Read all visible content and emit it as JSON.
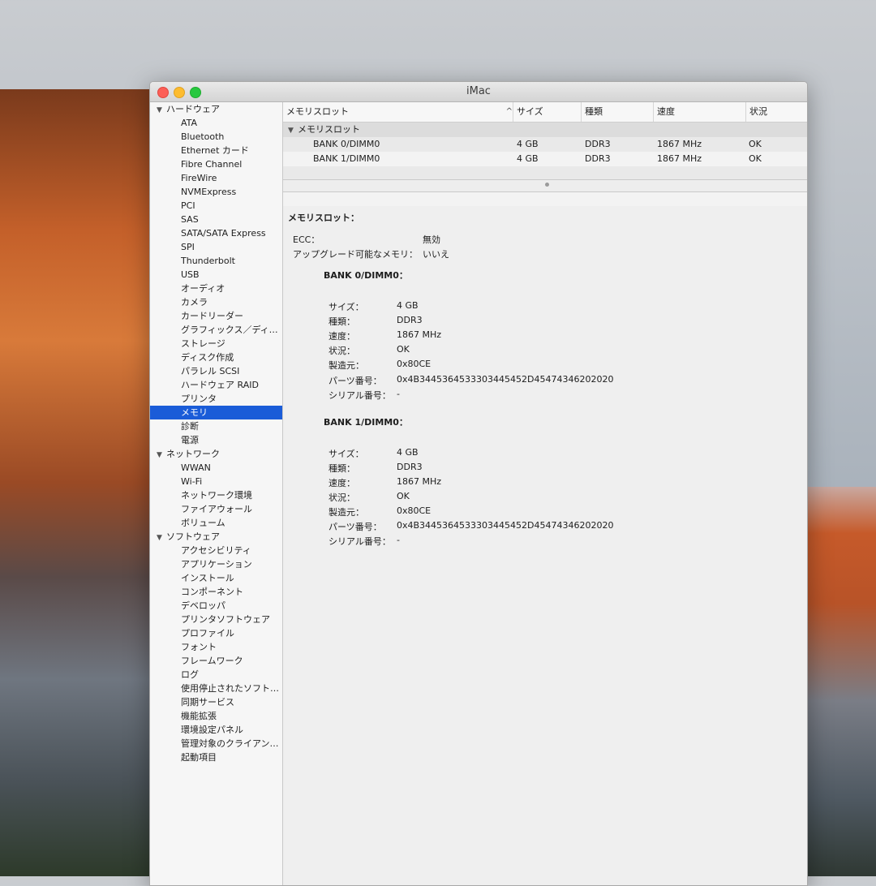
{
  "window": {
    "title": "iMac"
  },
  "sidebar": {
    "groups": [
      {
        "label": "ハードウェア",
        "items": [
          "ATA",
          "Bluetooth",
          "Ethernet カード",
          "Fibre Channel",
          "FireWire",
          "NVMExpress",
          "PCI",
          "SAS",
          "SATA/SATA Express",
          "SPI",
          "Thunderbolt",
          "USB",
          "オーディオ",
          "カメラ",
          "カードリーダー",
          "グラフィックス／ディ…",
          "ストレージ",
          "ディスク作成",
          "パラレル SCSI",
          "ハードウェア RAID",
          "プリンタ",
          "メモリ",
          "診断",
          "電源"
        ]
      },
      {
        "label": "ネットワーク",
        "items": [
          "WWAN",
          "Wi-Fi",
          "ネットワーク環境",
          "ファイアウォール",
          "ボリューム"
        ]
      },
      {
        "label": "ソフトウェア",
        "items": [
          "アクセシビリティ",
          "アプリケーション",
          "インストール",
          "コンポーネント",
          "デベロッパ",
          "プリンタソフトウェア",
          "プロファイル",
          "フォント",
          "フレームワーク",
          "ログ",
          "使用停止されたソフト…",
          "同期サービス",
          "機能拡張",
          "環境設定パネル",
          "管理対象のクライアン…",
          "起動項目"
        ]
      }
    ],
    "selected": "メモリ"
  },
  "table": {
    "headers": [
      "メモリスロット",
      "サイズ",
      "種類",
      "速度",
      "状況"
    ],
    "sort_indicator": "^",
    "group_label": "メモリスロット",
    "rows": [
      [
        "BANK 0/DIMM0",
        "4 GB",
        "DDR3",
        "1867 MHz",
        "OK"
      ],
      [
        "BANK 1/DIMM0",
        "4 GB",
        "DDR3",
        "1867 MHz",
        "OK"
      ]
    ]
  },
  "detail": {
    "title": "メモリスロット：",
    "ecc_label": "ECC：",
    "ecc_value": "無効",
    "upgrade_label": "アップグレード可能なメモリ：",
    "upgrade_value": "いいえ",
    "banks": [
      {
        "title": "BANK 0/DIMM0：",
        "fields": [
          [
            "サイズ：",
            "4 GB"
          ],
          [
            "種類：",
            "DDR3"
          ],
          [
            "速度：",
            "1867 MHz"
          ],
          [
            "状況：",
            "OK"
          ],
          [
            "製造元：",
            "0x80CE"
          ],
          [
            "パーツ番号：",
            "0x4B3445364533303445452D45474346202020"
          ],
          [
            "シリアル番号：",
            "-"
          ]
        ]
      },
      {
        "title": "BANK 1/DIMM0：",
        "fields": [
          [
            "サイズ：",
            "4 GB"
          ],
          [
            "種類：",
            "DDR3"
          ],
          [
            "速度：",
            "1867 MHz"
          ],
          [
            "状況：",
            "OK"
          ],
          [
            "製造元：",
            "0x80CE"
          ],
          [
            "パーツ番号：",
            "0x4B3445364533303445452D45474346202020"
          ],
          [
            "シリアル番号：",
            "-"
          ]
        ]
      }
    ]
  }
}
